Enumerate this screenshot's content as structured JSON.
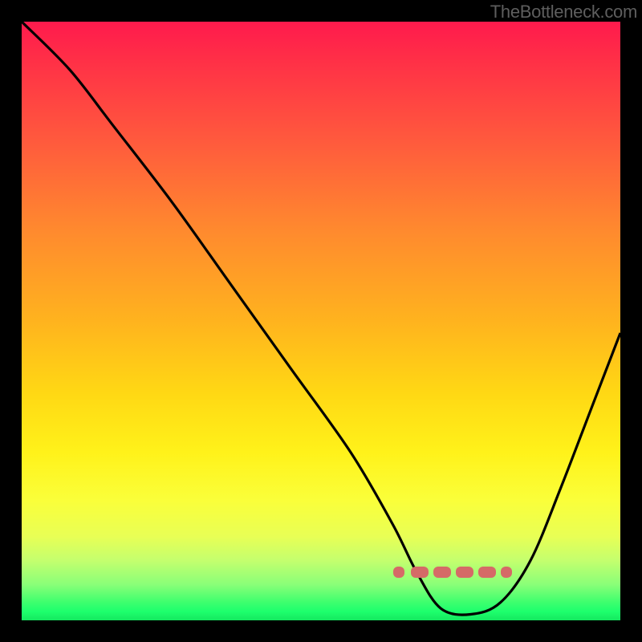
{
  "watermark": "TheBottleneck.com",
  "colors": {
    "frame": "#000000",
    "curve": "#000000",
    "dash": "#d56a67"
  },
  "chart_data": {
    "type": "line",
    "title": "",
    "xlabel": "",
    "ylabel": "",
    "xlim": [
      0,
      100
    ],
    "ylim": [
      0,
      100
    ],
    "series": [
      {
        "name": "bottleneck-curve",
        "x": [
          0,
          8,
          15,
          25,
          35,
          45,
          55,
          62,
          66,
          70,
          75,
          80,
          85,
          90,
          95,
          100
        ],
        "y": [
          100,
          92,
          83,
          70,
          56,
          42,
          28,
          16,
          8,
          2,
          1,
          3,
          10,
          22,
          35,
          48
        ]
      }
    ],
    "annotations": [
      {
        "name": "optimal-range-marker",
        "x_start": 62,
        "x_end": 82,
        "y": 8
      }
    ]
  }
}
